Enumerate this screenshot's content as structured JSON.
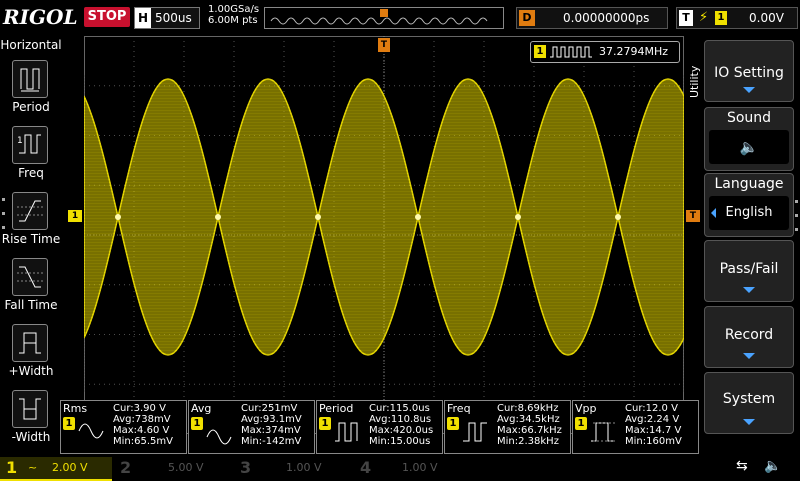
{
  "header": {
    "brand": "RIGOL",
    "run_state": "STOP",
    "hbase_key": "H",
    "hbase_value": "500us",
    "sample_rate": "1.00GSa/s",
    "mem_depth": "6.00M pts",
    "delay_key": "D",
    "delay_value": "0.00000000ps",
    "trigger_key": "T",
    "trigger_source": "1",
    "trigger_level": "0.00V"
  },
  "left_menu": {
    "title": "Horizontal",
    "items": [
      {
        "label": "Period",
        "icon": "period-icon"
      },
      {
        "label": "Freq",
        "icon": "freq-icon"
      },
      {
        "label": "Rise Time",
        "icon": "rise-time-icon"
      },
      {
        "label": "Fall Time",
        "icon": "fall-time-icon"
      },
      {
        "label": "+Width",
        "icon": "pos-width-icon"
      },
      {
        "label": "-Width",
        "icon": "neg-width-icon"
      }
    ]
  },
  "screen": {
    "freq_counter_channel": "1",
    "freq_counter_value": "37.2794MHz",
    "ch1_marker": "1",
    "trigger_marker": "T"
  },
  "right_menu": {
    "side_label": "Utility",
    "items": [
      {
        "label": "IO Setting",
        "value": ""
      },
      {
        "label": "Sound",
        "value": ""
      },
      {
        "label": "Language",
        "value": "English"
      },
      {
        "label": "Pass/Fail",
        "value": ""
      },
      {
        "label": "Record",
        "value": ""
      },
      {
        "label": "System",
        "value": ""
      }
    ]
  },
  "measurements": [
    {
      "name": "Rms",
      "ch": "1",
      "cur": "Cur:3.90 V",
      "avg": "Avg:738mV",
      "max": "Max:4.60 V",
      "min": "Min:65.5mV"
    },
    {
      "name": "Avg",
      "ch": "1",
      "cur": "Cur:251mV",
      "avg": "Avg:93.1mV",
      "max": "Max:374mV",
      "min": "Min:-142mV"
    },
    {
      "name": "Period",
      "ch": "1",
      "cur": "Cur:115.0us",
      "avg": "Avg:110.8us",
      "max": "Max:420.0us",
      "min": "Min:15.00us"
    },
    {
      "name": "Freq",
      "ch": "1",
      "cur": "Cur:8.69kHz",
      "avg": "Avg:34.5kHz",
      "max": "Max:66.7kHz",
      "min": "Min:2.38kHz"
    },
    {
      "name": "Vpp",
      "ch": "1",
      "cur": "Cur:12.0 V",
      "avg": "Avg:2.24 V",
      "max": "Max:14.7 V",
      "min": "Min:160mV"
    }
  ],
  "channels": [
    {
      "num": "1",
      "coupling": "~",
      "scale": "2.00 V",
      "color": "#f0e000"
    },
    {
      "num": "2",
      "coupling": "",
      "scale": "5.00 V",
      "color": "#00c8e0"
    },
    {
      "num": "3",
      "coupling": "",
      "scale": "1.00 V",
      "color": "#e040c0"
    },
    {
      "num": "4",
      "coupling": "",
      "scale": "1.00 V",
      "color": "#3060ff"
    }
  ],
  "colors": {
    "ch1": "#f0e000",
    "accent": "#4aa3ff",
    "stop": "#c8102e",
    "trigger": "#e07c10"
  }
}
